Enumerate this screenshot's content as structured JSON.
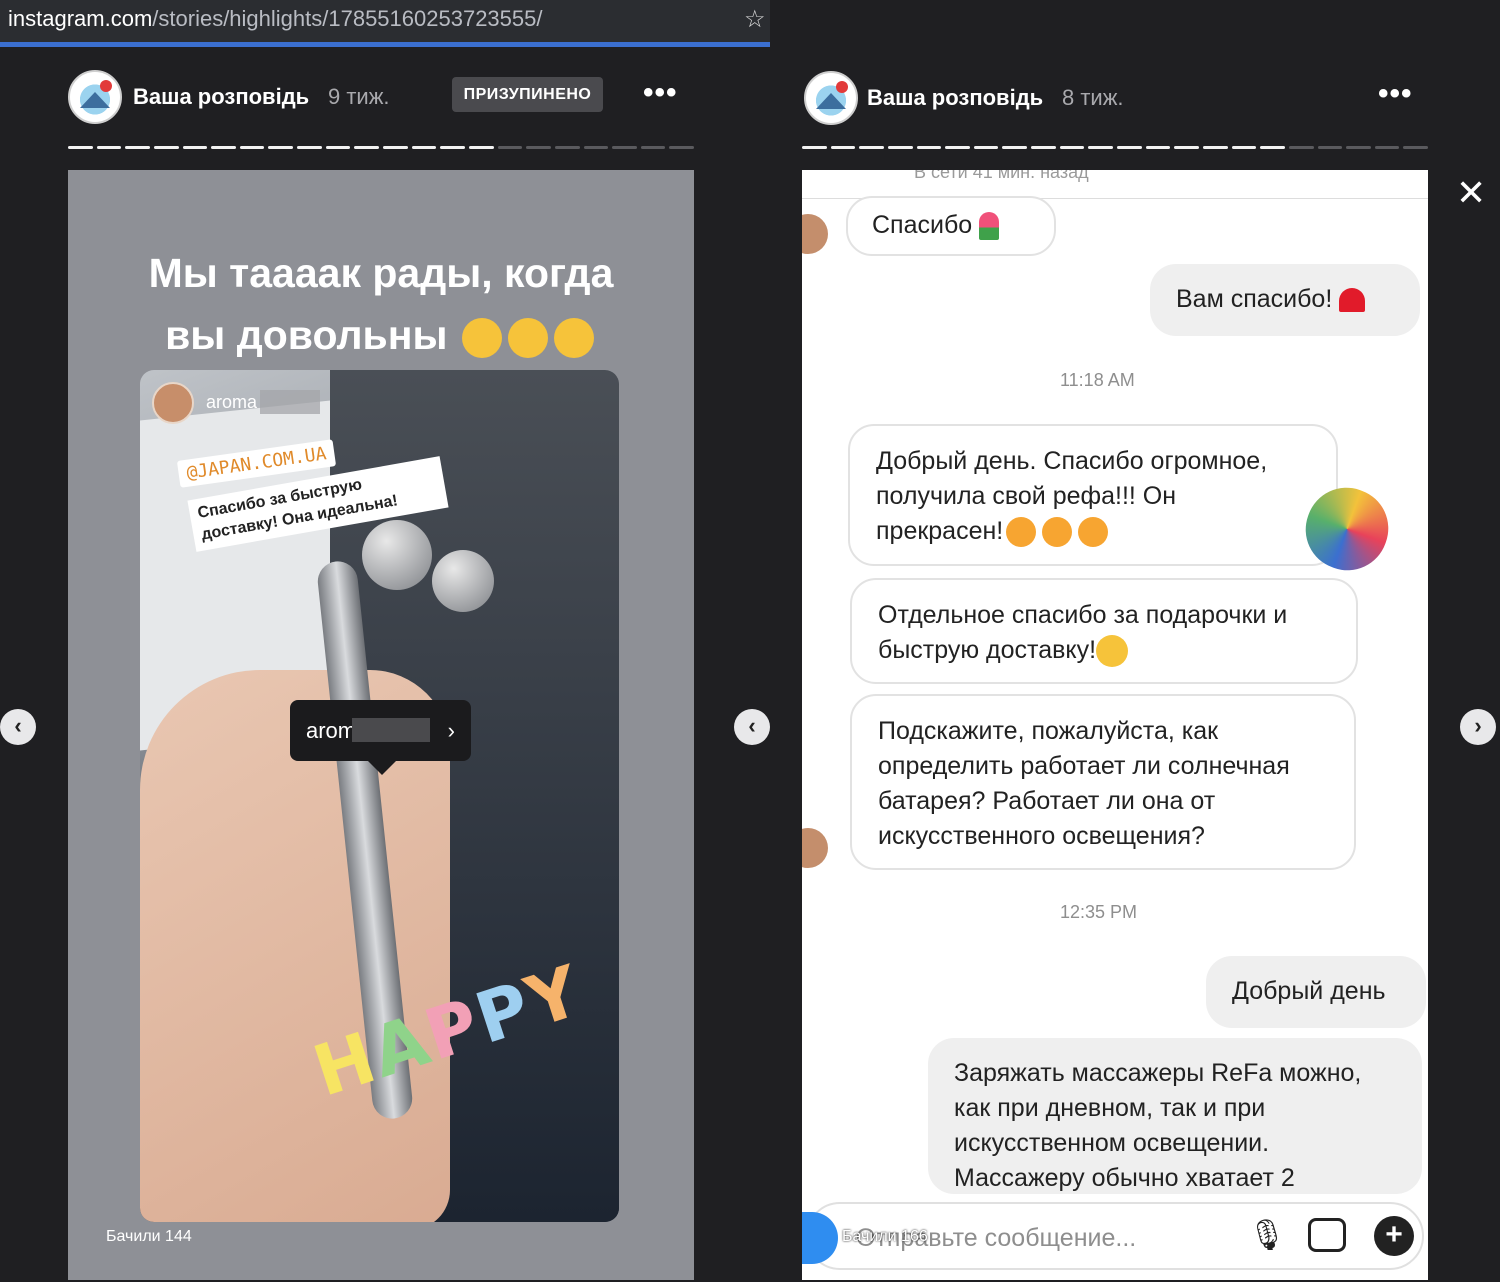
{
  "browser": {
    "url_host": "instagram.com",
    "url_path": "/stories/highlights/17855160253723555/",
    "bookmark_icon": "star-icon"
  },
  "left_story": {
    "header_name": "Ваша розповідь",
    "header_time": "9 тиж.",
    "paused_label": "ПРИЗУПИНЕНО",
    "more_label": "•••",
    "progress": {
      "total": 22,
      "done": 15
    },
    "title_line1": "Мы таааак рады, когда",
    "title_line2": "вы довольны",
    "embedded": {
      "username": "aroma",
      "tag": "@JAPAN.COM.UA",
      "caption": "Спасибо за быструю доставку! Она идеальна!",
      "sticker_text": "HAPPY"
    },
    "mention_label": "aroma",
    "views": "Бачили 144"
  },
  "right_story": {
    "header_name": "Ваша розповідь",
    "header_time": "8 тиж.",
    "more_label": "•••",
    "progress": {
      "total": 22,
      "done": 17
    },
    "online_status": "В сети 41 мин. назад",
    "messages": {
      "m1": "Спасибо",
      "m2": "Вам спасибо!",
      "time1": "11:18 AM",
      "m3": "Добрый день. Спасибо огромное, получила свой рефа!!! Он прекрасен!",
      "m4": "Отдельное спасибо за подарочки и быструю доставку!",
      "m5": "Подскажите, пожалуйста, как определить работает ли солнечная батарея? Работает ли она от искусственного освещения?",
      "time2": "12:35 PM",
      "m6": "Добрый день",
      "m7": "Заряжать массажеры ReFa можно, как при дневном, так и при искусственном освещении. Массажеру обычно хватает 2"
    },
    "input_placeholder": "Отправьте сообщение...",
    "views": "Бачили 166"
  },
  "nav": {
    "prev_symbol": "‹",
    "next_symbol": "›",
    "close_symbol": "✕"
  }
}
